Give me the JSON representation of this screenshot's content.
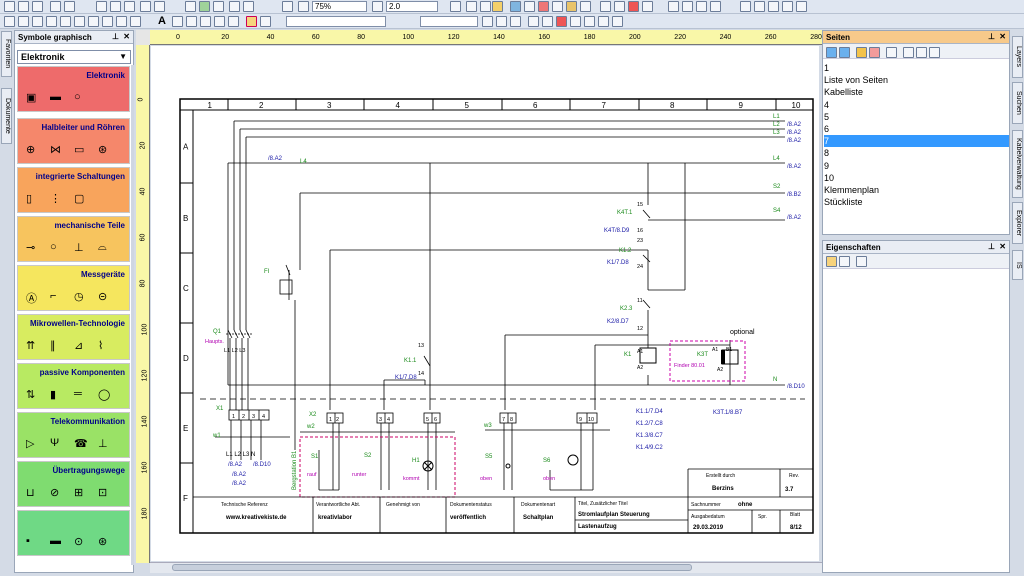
{
  "toolbar": {
    "zoom_value": "75%",
    "linewidth_value": "2.0",
    "text_icon": "A"
  },
  "symbols": {
    "title": "Symbole graphisch",
    "close": "✕",
    "dropdown_value": "Elektronik",
    "categories": [
      {
        "label": "Elektronik",
        "color": "#ee6b6b"
      },
      {
        "label": "Halbleiter und Röhren",
        "color": "#f5876b"
      },
      {
        "label": "integrierte Schaltungen",
        "color": "#f8a45c"
      },
      {
        "label": "mechanische Teile",
        "color": "#f7c45e"
      },
      {
        "label": "Messgeräte",
        "color": "#f5e65e"
      },
      {
        "label": "Mikrowellen-Technologie",
        "color": "#d8ec60"
      },
      {
        "label": "passive Komponenten",
        "color": "#b8ea62"
      },
      {
        "label": "Telekommunikation",
        "color": "#9ae266"
      },
      {
        "label": "Übertragungswege",
        "color": "#7fdc70"
      },
      {
        "label": "",
        "color": "#6fd985"
      }
    ]
  },
  "left_tabs": {
    "favorites": "Favoriten",
    "documents": "Dokumente"
  },
  "ruler": {
    "h_ticks": [
      "0",
      "20",
      "40",
      "60",
      "80",
      "100",
      "120",
      "140",
      "160",
      "180",
      "200",
      "220",
      "240",
      "260",
      "280"
    ],
    "v_ticks": [
      "0",
      "20",
      "40",
      "60",
      "80",
      "100",
      "120",
      "140",
      "160",
      "180"
    ]
  },
  "pages": {
    "title": "Seiten",
    "items": [
      "1",
      "Liste von Seiten",
      "Kabelliste",
      "4",
      "5",
      "6",
      "7",
      "8",
      "9",
      "10",
      "Klemmenplan",
      "Stückliste"
    ],
    "selected_index": 6
  },
  "properties": {
    "title": "Eigenschaften"
  },
  "right_tabs": [
    "Layers",
    "Suchen",
    "Kabelverwaltung",
    "Explorer",
    "IS"
  ],
  "drawing": {
    "columns": [
      "1",
      "2",
      "3",
      "4",
      "5",
      "6",
      "7",
      "8",
      "9",
      "10"
    ],
    "rows": [
      "A",
      "B",
      "C",
      "D",
      "E",
      "F"
    ],
    "lines": [
      {
        "label": "L1",
        "ref": "/8.A2"
      },
      {
        "label": "L2",
        "ref": "/8.A2"
      },
      {
        "label": "L3",
        "ref": "/8.A2"
      },
      {
        "label": "L4",
        "ref": "/8.A2"
      },
      {
        "label": "S2",
        "ref": "/8.B2"
      },
      {
        "label": "S4",
        "ref": "/8.A2"
      },
      {
        "label": "N",
        "ref": "/8.D10"
      }
    ],
    "left_ref": "/8.A2",
    "l4_left": "L4",
    "components": {
      "q1": "Q1",
      "q1_sub": "Haupts.",
      "q1_poles": "L1  L2  L3",
      "fi": "FI",
      "k4t1": "K4T.1",
      "k4t1_ref": "K4T/8.D9",
      "k4t1_a": "15",
      "k4t1_b": "16",
      "k4t1_c": "23",
      "k12": "K1.2",
      "k12_ref": "K1/7.D8",
      "k12_n": "24",
      "k23": "K2.3",
      "k23_ref": "K2/8.D7",
      "k23_a": "11",
      "k23_b": "12",
      "optional": "optional",
      "k1": "K1",
      "k1_a1": "A1",
      "k1_a2": "A2",
      "k3t": "K3T",
      "k3t_a1": "A1",
      "k3t_b1": "B1",
      "k3t_a2": "A2",
      "finder": "Finder 80.01",
      "k11": "K1.1",
      "k11_ref": "K1/7.D8",
      "k11_a": "13",
      "k11_b": "14",
      "x1": "X1",
      "x2": "X2",
      "w1": "w1",
      "w2": "w2",
      "w3": "w3",
      "x1_terms": [
        "1",
        "2",
        "3",
        "4"
      ],
      "x2_terms": [
        "1",
        "2"
      ],
      "t34": [
        "3",
        "4"
      ],
      "t56": [
        "5",
        "6"
      ],
      "t78": [
        "7",
        "8"
      ],
      "t910": [
        "9",
        "10"
      ],
      "bottom_labels": "L1 L2 L3 N",
      "bottom_refs": [
        "/8.A2",
        "/8.A2",
        "/8.A2",
        "/8.D10"
      ],
      "bergstation": "Bergstation B1",
      "s1": "S1",
      "s1_sub": "rauf",
      "s2": "S2",
      "s2_sub": "runter",
      "h1": "H1",
      "h1_sub": "kommt",
      "s5": "S5",
      "s5_sub": "oben",
      "s6": "S6",
      "s6_sub": "oben",
      "k1_contacts": [
        "K1.1/7.D4",
        "K1.2/7.C8",
        "K1.3/8.C7",
        "K1.4/9.C2"
      ],
      "k3t_contact": "K3T.1/8.B7"
    },
    "titleblock": {
      "erstellt_label": "Erstellt durch",
      "erstellt": "Berzins",
      "rev_label": "Rev.",
      "rev": "3.7",
      "tech_label": "Technische Referenz",
      "tech": "www.kreativekiste.de",
      "abt_label": "Verantwortliche Abt.",
      "abt": "kreativlabor",
      "gen_label": "Genehmigt von",
      "gen": "",
      "status_label": "Dokumentenstatus",
      "status": "veröffentlich",
      "art_label": "Dokumentenart",
      "art": "Schaltplan",
      "titel_label": "Titel, Zusätzlicher Titel",
      "titel1": "Stromlaufplan Steuerung",
      "titel2": "Lastenaufzug",
      "sach_label": "Sachnummer",
      "sach": "ohne",
      "datum_label": "Ausgabedatum",
      "datum": "29.03.2019",
      "spr_label": "Spr.",
      "blatt_label": "Blatt",
      "blatt": "8/12"
    }
  }
}
